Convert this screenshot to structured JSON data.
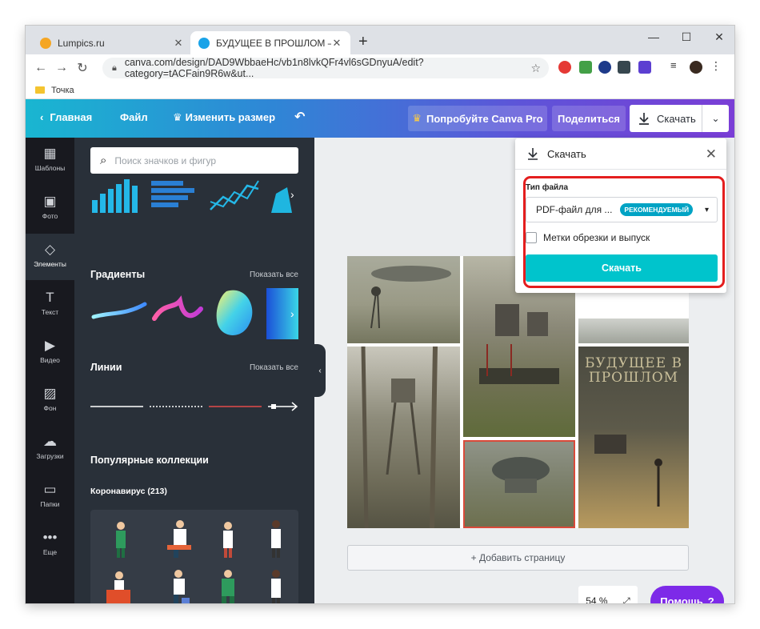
{
  "browser": {
    "tabs": [
      {
        "title": "Lumpics.ru",
        "favicon_color": "#f5a623"
      },
      {
        "title": "БУДУЩЕЕ В ПРОШЛОМ — Фото",
        "favicon_color": "#1aa3e8"
      }
    ],
    "new_tab": "+",
    "window_controls": {
      "minimize": "—",
      "maximize": "☐",
      "close": "✕"
    },
    "url": "canva.com/design/DAD9WbbaeHc/vb1n8lvkQFr4vl6sGDnyuA/edit?category=tACFain9R6w&ut...",
    "bookmark": "Точка"
  },
  "canva_header": {
    "home": "Главная",
    "file": "Файл",
    "resize": "Изменить размер",
    "undo": "↶",
    "try_pro": "Попробуйте Canva Pro",
    "share": "Поделиться",
    "download": "Скачать",
    "accent": "#7d2ae8"
  },
  "rail": [
    {
      "label": "Шаблоны",
      "icon": "▦"
    },
    {
      "label": "Фото",
      "icon": "▣"
    },
    {
      "label": "Элементы",
      "icon": "◇"
    },
    {
      "label": "Текст",
      "icon": "T"
    },
    {
      "label": "Видео",
      "icon": "▶"
    },
    {
      "label": "Фон",
      "icon": "▨"
    },
    {
      "label": "Загрузки",
      "icon": "☁"
    },
    {
      "label": "Папки",
      "icon": "▭"
    },
    {
      "label": "Еще",
      "icon": "•••"
    }
  ],
  "panel": {
    "search_placeholder": "Поиск значков и фигур",
    "gradients_title": "Градиенты",
    "gradients_show_all": "Показать все",
    "lines_title": "Линии",
    "lines_show_all": "Показать все",
    "collections_title": "Популярные коллекции",
    "collection_name": "Коронавирус (213)"
  },
  "canvas": {
    "poster_title": "БУДУЩЕЕ В ПРОШЛОМ",
    "add_page": "+ Добавить страницу",
    "zoom": "54 %",
    "help": "Помощь",
    "help_icon": "?"
  },
  "download_popup": {
    "title": "Скачать",
    "file_type_label": "Тип файла",
    "file_type_value": "PDF-файл для ...",
    "recommended_badge": "РЕКОМЕНДУЕМЫЙ",
    "crop_marks_label": "Метки обрезки и выпуск",
    "download_button": "Скачать",
    "highlight_color": "#e41e1e"
  }
}
